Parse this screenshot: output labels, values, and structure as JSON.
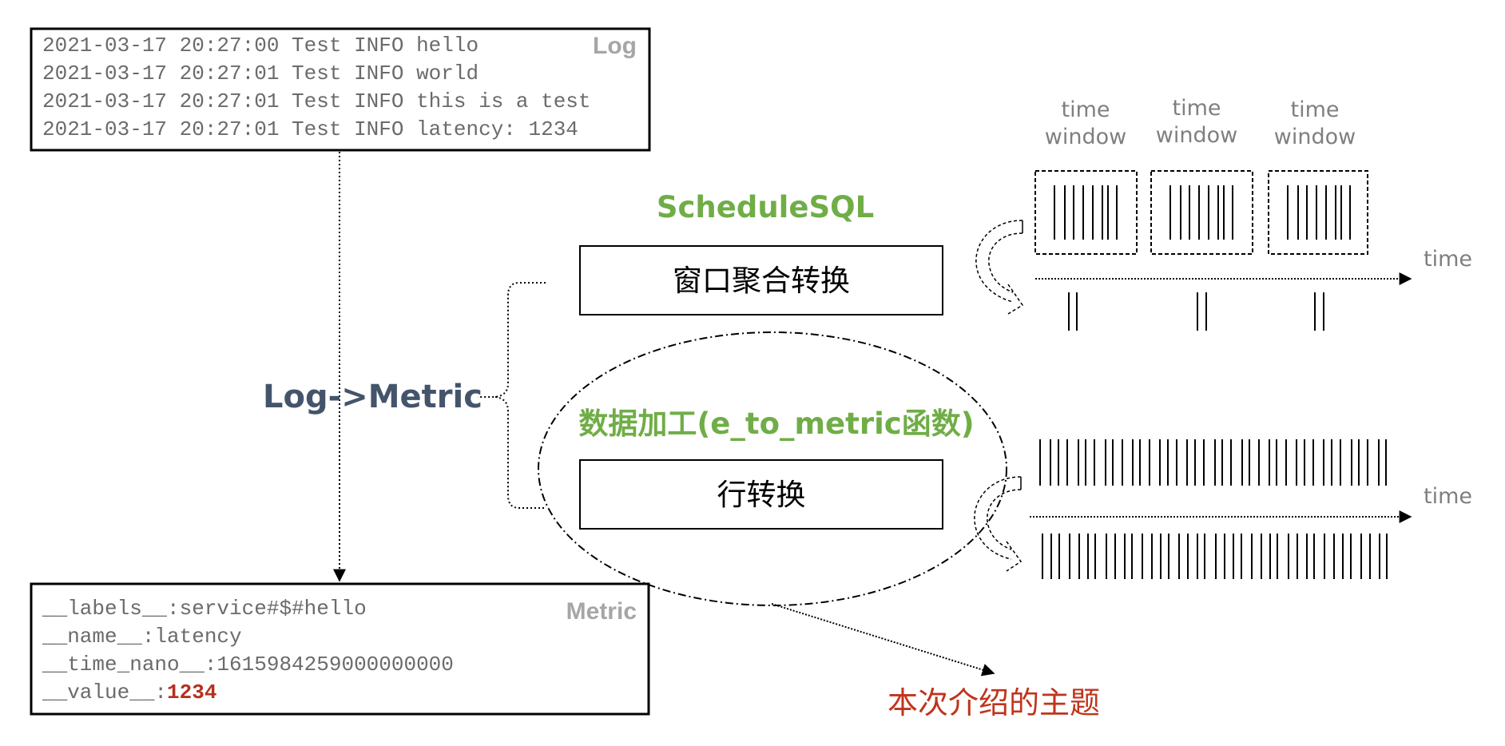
{
  "log_box": {
    "tag": "Log",
    "lines": [
      "2021-03-17 20:27:00 Test INFO hello",
      "2021-03-17 20:27:01 Test INFO world",
      "2021-03-17 20:27:01 Test INFO this is a test",
      "2021-03-17 20:27:01 Test INFO latency: 1234"
    ]
  },
  "metric_box": {
    "tag": "Metric",
    "lines": [
      "__labels__:service#$#hello",
      "__name__:latency",
      "__time_nano__:1615984259000000000"
    ],
    "value_key": "__value__:",
    "value": "1234"
  },
  "conversion_label": "Log->Metric",
  "schedule_sql": {
    "title": "ScheduleSQL",
    "box_label": "窗口聚合转换"
  },
  "data_processing": {
    "title": "数据加工(e_to_metric函数)",
    "box_label": "行转换"
  },
  "topic_note": "本次介绍的主题",
  "timeline_top": {
    "window_labels": [
      [
        "time",
        "window"
      ],
      [
        "time",
        "window"
      ],
      [
        "time",
        "window"
      ]
    ],
    "axis_label": "time"
  },
  "timeline_bottom": {
    "axis_label": "time"
  },
  "colors": {
    "green": "#70ad47",
    "blue": "#44546a",
    "red": "#c0341c",
    "gray": "#7f7f7f"
  }
}
